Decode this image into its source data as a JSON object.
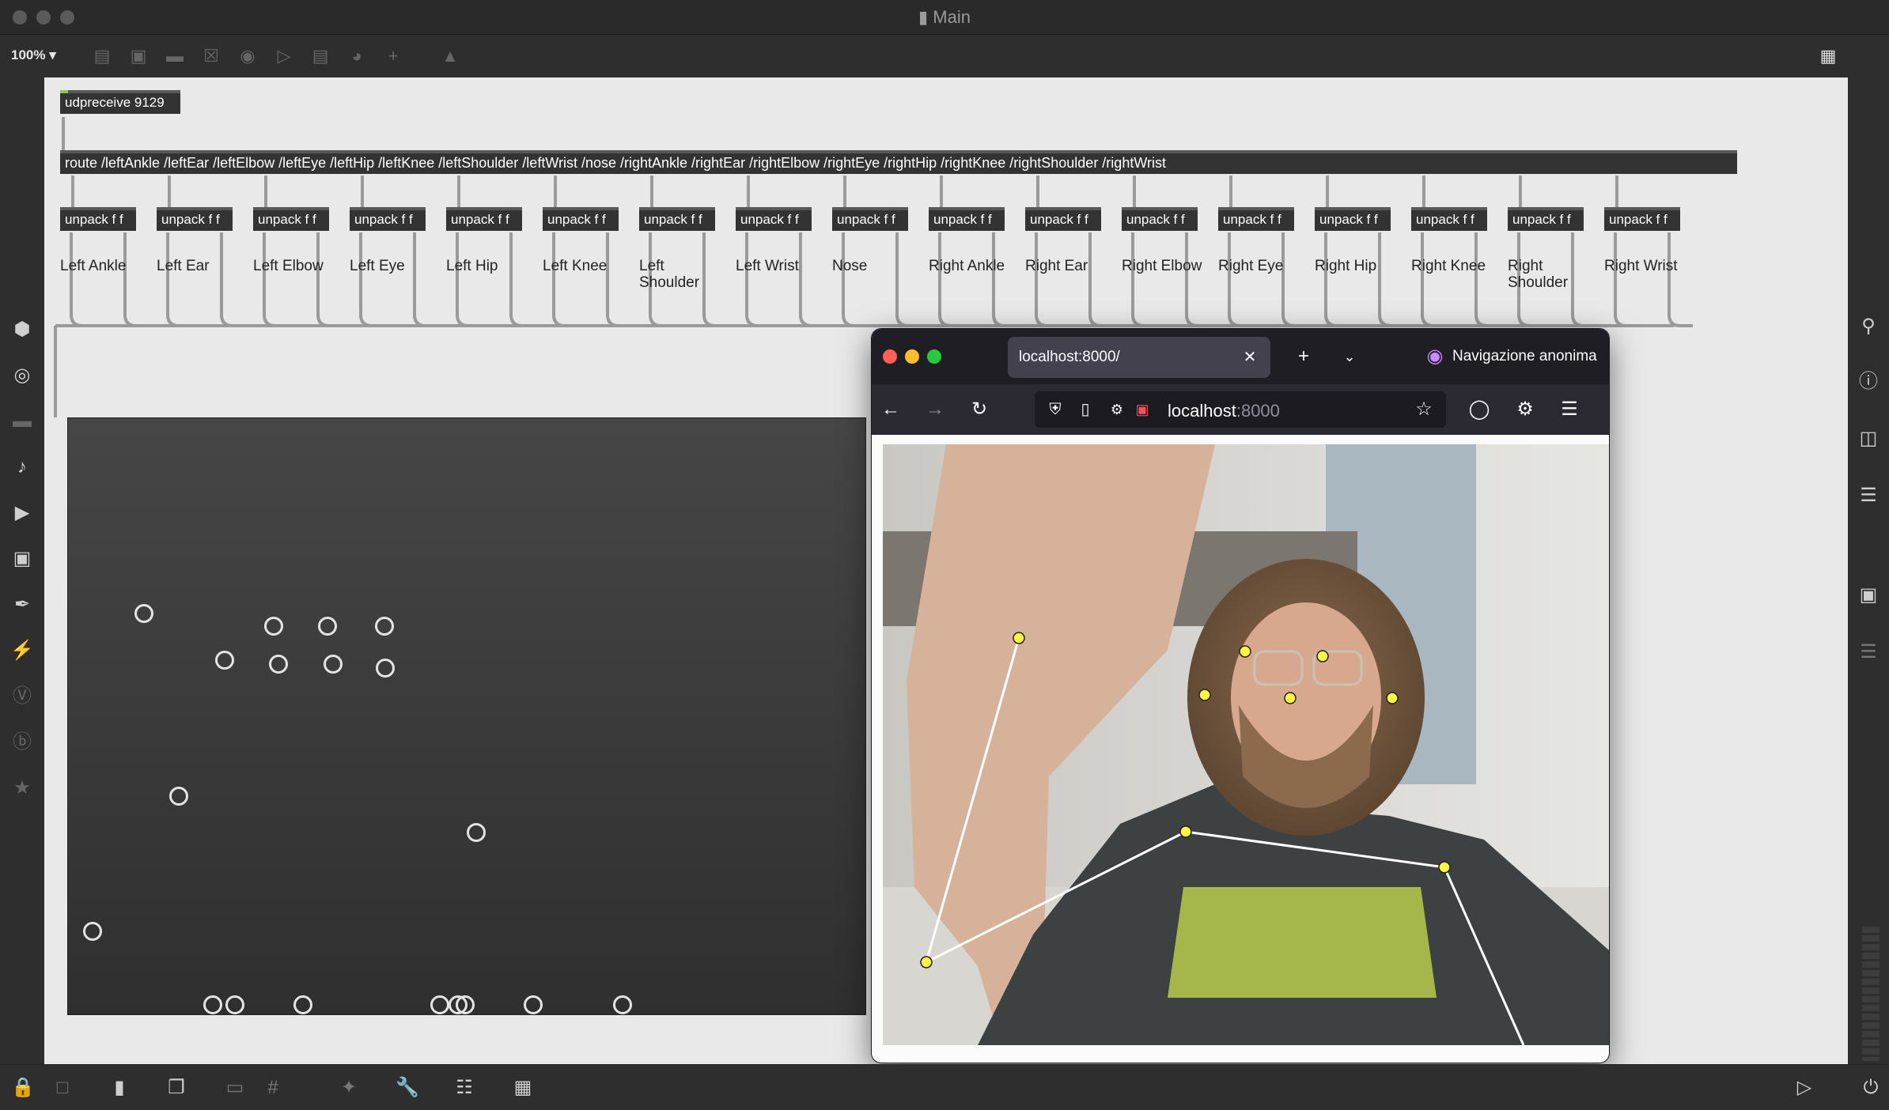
{
  "window": {
    "title": "Main",
    "zoom": "100%"
  },
  "patch": {
    "udpreceive": "udpreceive 9129",
    "route": "route /leftAnkle /leftEar /leftElbow /leftEye /leftHip /leftKnee /leftShoulder /leftWrist /nose /rightAnkle /rightEar /rightElbow /rightEye /rightHip /rightKnee /rightShoulder /rightWrist",
    "unpack_label": "unpack f f",
    "labels": [
      "Left Ankle",
      "Left Ear",
      "Left Elbow",
      "Left Eye",
      "Left Hip",
      "Left Knee",
      "Left Shoulder",
      "Left Wrist",
      "Nose",
      "Right Ankle",
      "Right Ear",
      "Right Elbow",
      "Right Eye",
      "Right Hip",
      "Right Knee",
      "Right Shoulder",
      "Right Wrist"
    ],
    "labels_display": [
      "Left Ankle",
      "Left Ear",
      "Left Elbow",
      "Left Eye",
      "Left Hip",
      "Left Knee",
      "Left\nShoulder",
      "Left Wrist",
      "Nose",
      "Right Ankle",
      "Right Ear",
      "Right Elbow",
      "Right Eye",
      "Right Hip",
      "Right Knee",
      "Right\nShoulder",
      "Right Wrist"
    ]
  },
  "browser": {
    "tab_title": "localhost:8000/",
    "private_label": "Navigazione anonima",
    "url_host": "localhost",
    "url_port": ":8000"
  },
  "icons": {
    "left_rail": [
      "cube-icon",
      "target-icon",
      "ruler-icon",
      "music-note-icon",
      "media-icon",
      "image-icon",
      "paperclip-icon",
      "plug-icon",
      "v-circle-icon",
      "b-circle-icon",
      "star-icon"
    ],
    "right_rail": [
      "search-icon",
      "info-icon",
      "book-icon",
      "list-icon",
      "camera-icon",
      "sliders-icon"
    ],
    "bottom": [
      "lock-icon",
      "edit-icon",
      "presentation-icon",
      "windows-icon",
      "hide-icon",
      "grid-icon",
      "snap-icon",
      "wrench-icon",
      "piano-icon",
      "keyboard-icon",
      "play-icon",
      "power-icon"
    ]
  }
}
